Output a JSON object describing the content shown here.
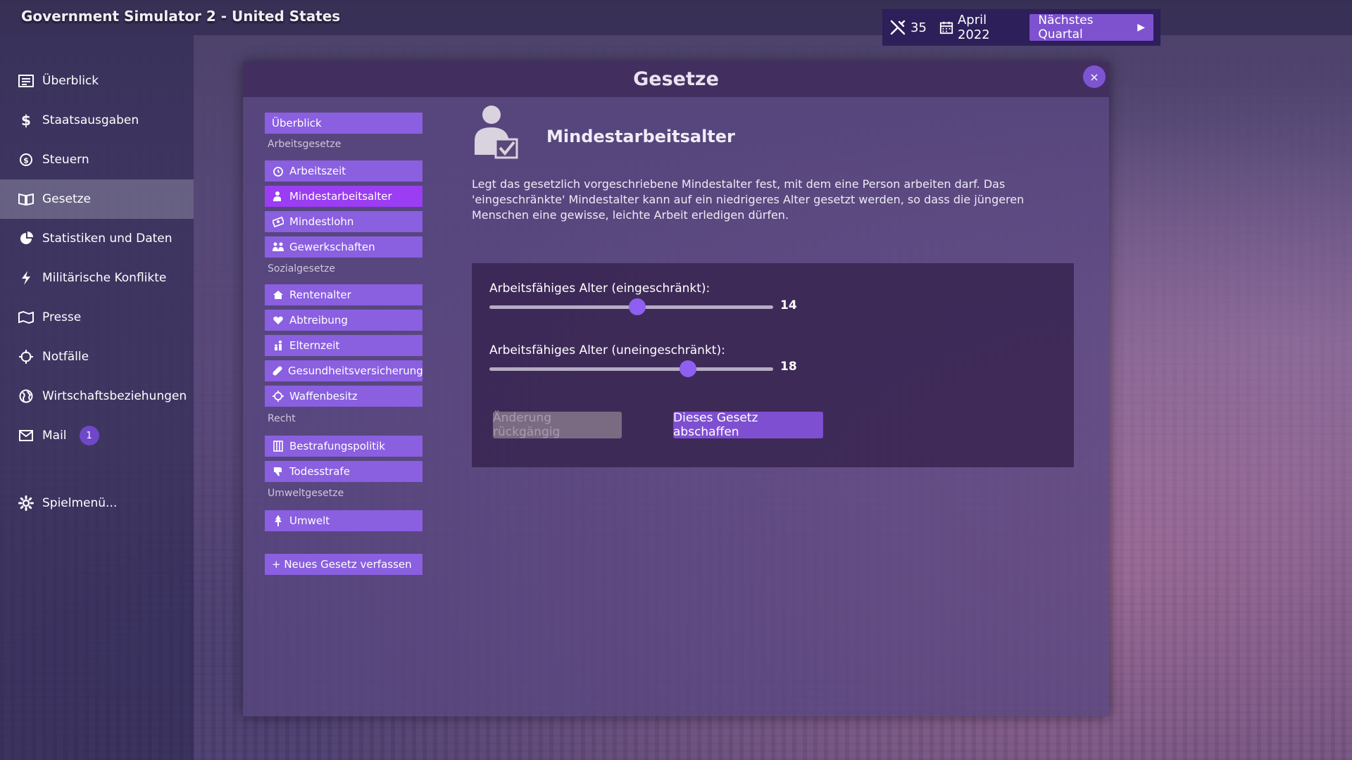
{
  "app": {
    "title": "Government Simulator 2 - United States"
  },
  "status": {
    "points": "35",
    "date": "April 2022",
    "next_button": "Nächstes Quartal",
    "next_arrow": "▶"
  },
  "sidebar": {
    "items": [
      {
        "label": "Überblick",
        "icon": "overview-icon"
      },
      {
        "label": "Staatsausgaben",
        "icon": "dollar-icon"
      },
      {
        "label": "Steuern",
        "icon": "coin-icon"
      },
      {
        "label": "Gesetze",
        "icon": "book-icon",
        "active": true
      },
      {
        "label": "Statistiken und Daten",
        "icon": "pie-chart-icon"
      },
      {
        "label": "Militärische Konflikte",
        "icon": "lightning-icon"
      },
      {
        "label": "Presse",
        "icon": "map-icon"
      },
      {
        "label": "Notfälle",
        "icon": "crosshair-icon"
      },
      {
        "label": "Wirtschaftsbeziehungen",
        "icon": "globe-icon"
      },
      {
        "label": "Mail",
        "icon": "mail-icon",
        "badge": "1"
      },
      {
        "label": "Spielmenü...",
        "icon": "gear-icon"
      }
    ]
  },
  "modal": {
    "title": "Gesetze",
    "close": "×"
  },
  "laws": {
    "overview": "Überblick",
    "categories": {
      "work": "Arbeitsgesetze",
      "social": "Sozialgesetze",
      "law": "Recht",
      "environment": "Umweltgesetze"
    },
    "items": {
      "arbeitszeit": "Arbeitszeit",
      "mindestarbeitsalter": "Mindestarbeitsalter",
      "mindestlohn": "Mindestlohn",
      "gewerkschaften": "Gewerkschaften",
      "rentenalter": "Rentenalter",
      "abtreibung": "Abtreibung",
      "elternzeit": "Elternzeit",
      "gesundheitsversicherung": "Gesundheitsversicherung",
      "waffenbesitz": "Waffenbesitz",
      "bestrafungspolitik": "Bestrafungspolitik",
      "todesstrafe": "Todesstrafe",
      "umwelt": "Umwelt"
    },
    "new_law": "+ Neues Gesetz verfassen"
  },
  "detail": {
    "title": "Mindestarbeitsalter",
    "description": "Legt das gesetzlich vorgeschriebene Mindestalter fest, mit dem eine Person arbeiten darf. Das 'eingeschränkte' Mindestalter kann auf ein niedrigeres Alter gesetzt werden, so dass die jüngeren Menschen eine gewisse, leichte Arbeit erledigen dürfen.",
    "slider_restricted": {
      "label": "Arbeitsfähiges Alter (eingeschränkt):",
      "value": "14",
      "fraction": 0.52
    },
    "slider_unrestricted": {
      "label": "Arbeitsfähiges Alter (uneingeschränkt):",
      "value": "18",
      "fraction": 0.7
    },
    "undo_button": "Änderung rückgängig",
    "abolish_button": "Dieses Gesetz abschaffen"
  },
  "colors": {
    "accent": "#8a5fe0",
    "active_law": "#9b3df2",
    "status_bg": "#2c1f5a"
  }
}
